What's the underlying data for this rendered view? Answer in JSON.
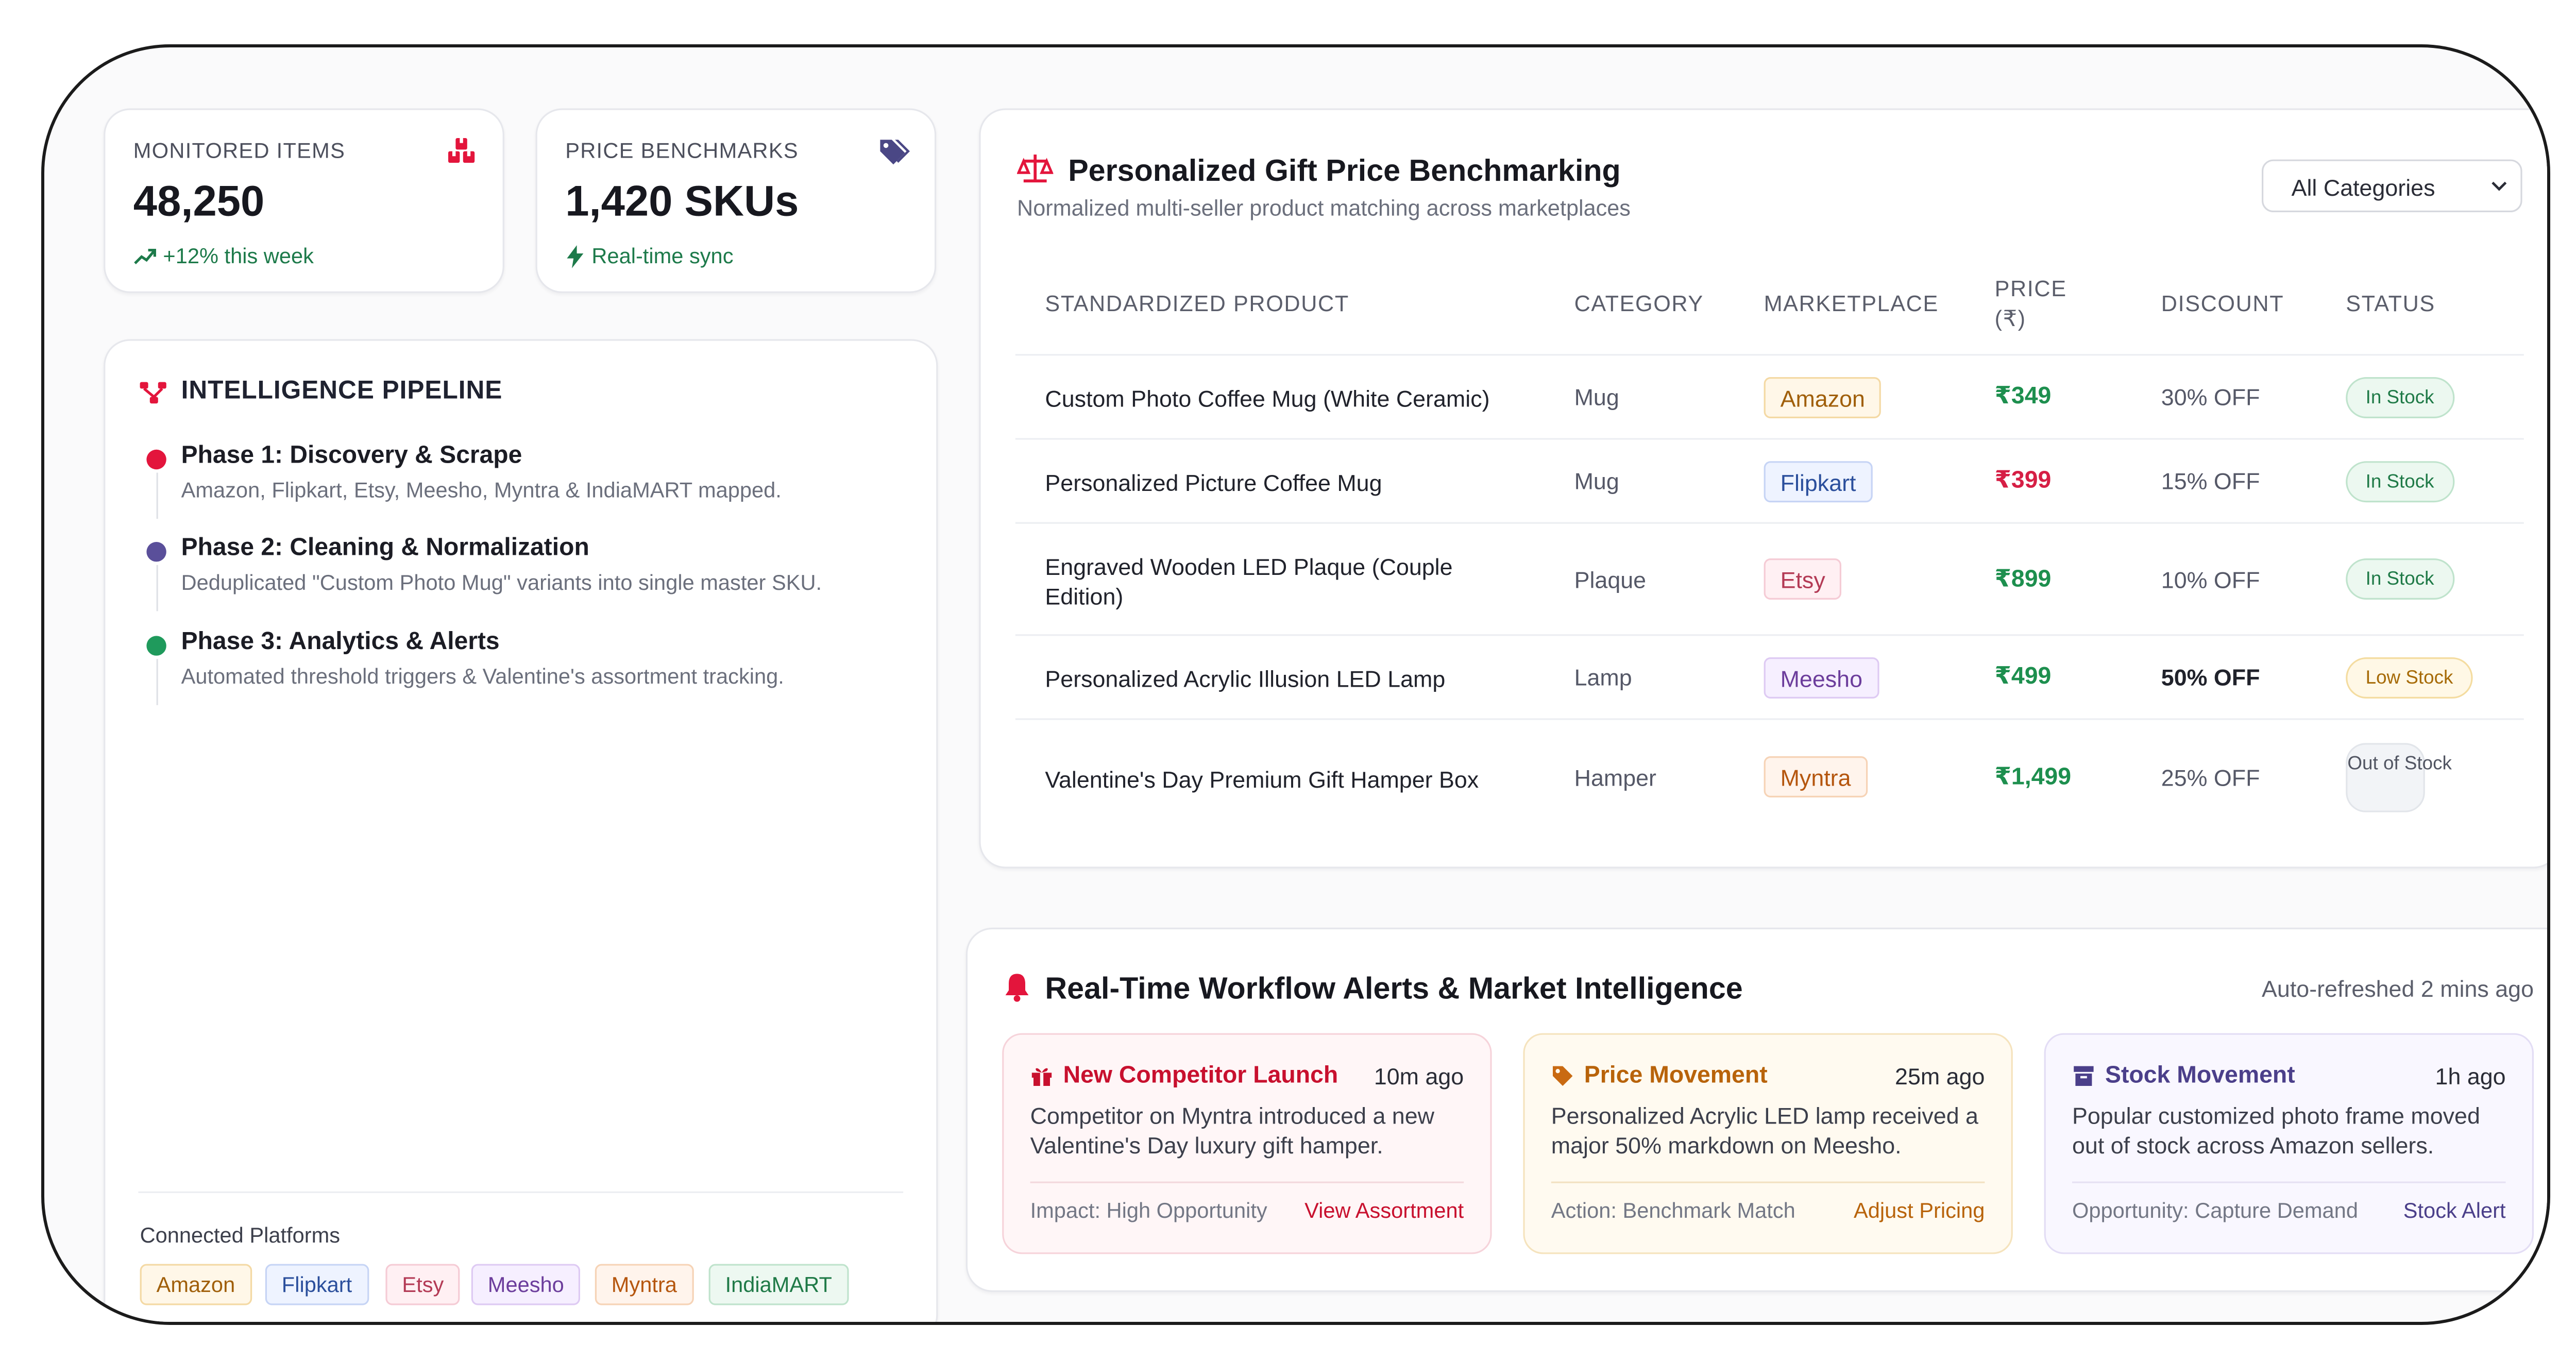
{
  "stats": {
    "monitored": {
      "label": "MONITORED ITEMS",
      "value": "48,250",
      "sub": "+12% this week",
      "icon": "boxes-icon"
    },
    "benchmarks": {
      "label": "PRICE BENCHMARKS",
      "value": "1,420 SKUs",
      "sub": "Real-time sync",
      "icon": "tags-icon"
    }
  },
  "pipeline": {
    "title": "INTELLIGENCE PIPELINE",
    "phases": [
      {
        "name": "Phase 1: Discovery & Scrape",
        "desc": "Amazon, Flipkart, Etsy, Meesho, Myntra & IndiaMART mapped.",
        "color": "#e3153c"
      },
      {
        "name": "Phase 2: Cleaning & Normalization",
        "desc": "Deduplicated \"Custom Photo Mug\" variants into single master SKU.",
        "color": "#5a4f9a"
      },
      {
        "name": "Phase 3: Analytics & Alerts",
        "desc": "Automated threshold triggers & Valentine's assortment tracking.",
        "color": "#1f9a5c"
      }
    ],
    "platforms_label": "Connected Platforms",
    "platforms": [
      "Amazon",
      "Flipkart",
      "Etsy",
      "Meesho",
      "Myntra",
      "IndiaMART"
    ]
  },
  "benchmark": {
    "title": "Personalized Gift Price Benchmarking",
    "subtitle": "Normalized multi-seller product matching across marketplaces",
    "filter": "All Categories",
    "columns": [
      "STANDARDIZED PRODUCT",
      "CATEGORY",
      "MARKETPLACE",
      "PRICE (₹)",
      "DISCOUNT",
      "STATUS"
    ],
    "rows": [
      {
        "product": "Custom Photo Coffee Mug (White Ceramic)",
        "category": "Mug",
        "marketplace": "Amazon",
        "price": "₹349",
        "price_color": "#1d8f4e",
        "discount": "30% OFF",
        "status": "In Stock"
      },
      {
        "product": "Personalized Picture Coffee Mug",
        "category": "Mug",
        "marketplace": "Flipkart",
        "price": "₹399",
        "price_color": "#d61f45",
        "discount": "15% OFF",
        "status": "In Stock"
      },
      {
        "product": "Engraved Wooden LED Plaque (Couple Edition)",
        "category": "Plaque",
        "marketplace": "Etsy",
        "price": "₹899",
        "price_color": "#1d8f4e",
        "discount": "10% OFF",
        "status": "In Stock"
      },
      {
        "product": "Personalized Acrylic Illusion LED Lamp",
        "category": "Lamp",
        "marketplace": "Meesho",
        "price": "₹499",
        "price_color": "#1d8f4e",
        "discount": "50% OFF",
        "status": "Low Stock"
      },
      {
        "product": "Valentine's Day Premium Gift Hamper Box",
        "category": "Hamper",
        "marketplace": "Myntra",
        "price": "₹1,499",
        "price_color": "#1d8f4e",
        "discount": "25% OFF",
        "status": "Out of Stock"
      }
    ]
  },
  "alerts": {
    "title": "Real-Time Workflow Alerts & Market Intelligence",
    "refreshed": "Auto-refreshed 2 mins ago",
    "items": [
      {
        "title": "New Competitor Launch",
        "time": "10m ago",
        "text": "Competitor on Myntra introduced a new Valentine's Day luxury gift hamper.",
        "footer": "Impact: High Opportunity",
        "action": "View Assortment",
        "icon": "gift-icon"
      },
      {
        "title": "Price Movement",
        "time": "25m ago",
        "text": "Personalized Acrylic LED lamp received a major 50% markdown on Meesho.",
        "footer": "Action: Benchmark Match",
        "action": "Adjust Pricing",
        "icon": "tag-icon"
      },
      {
        "title": "Stock Movement",
        "time": "1h ago",
        "text": "Popular customized photo frame moved out of stock across Amazon sellers.",
        "footer": "Opportunity: Capture Demand",
        "action": "Stock Alert",
        "icon": "archive-icon"
      }
    ]
  }
}
